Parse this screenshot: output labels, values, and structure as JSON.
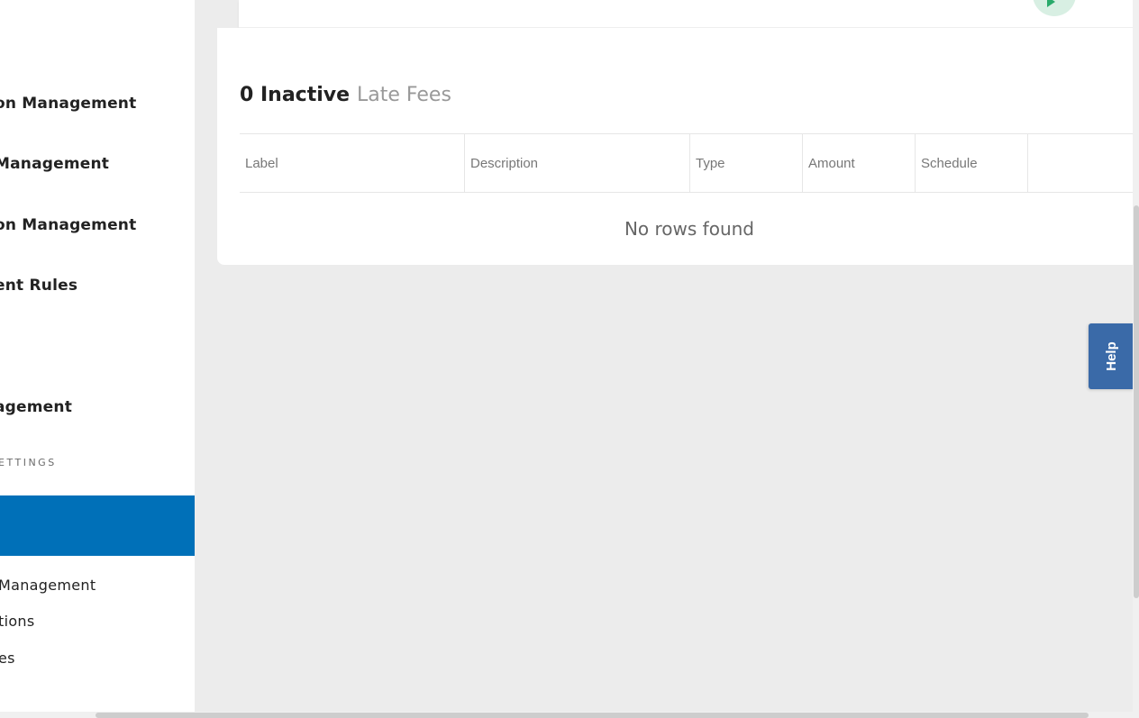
{
  "sidebar": {
    "items": [
      {
        "label": "on Management"
      },
      {
        "label": " Management"
      },
      {
        "label": "on Management"
      },
      {
        "label": "ent Rules"
      },
      {
        "label": "agement"
      }
    ],
    "section_heading": "ETTINGS",
    "sub_items": [
      {
        "label": "Management"
      },
      {
        "label": "tions"
      },
      {
        "label": "es"
      }
    ]
  },
  "late_fees": {
    "count": "0 Inactive",
    "label": "Late Fees",
    "columns": [
      "Label",
      "Description",
      "Type",
      "Amount",
      "Schedule",
      ""
    ],
    "empty_message": "No rows found"
  },
  "help": {
    "label": "Help"
  },
  "colors": {
    "active_sidebar": "#0070b8",
    "help_tab": "#3a6aa8",
    "background": "#ececec"
  }
}
